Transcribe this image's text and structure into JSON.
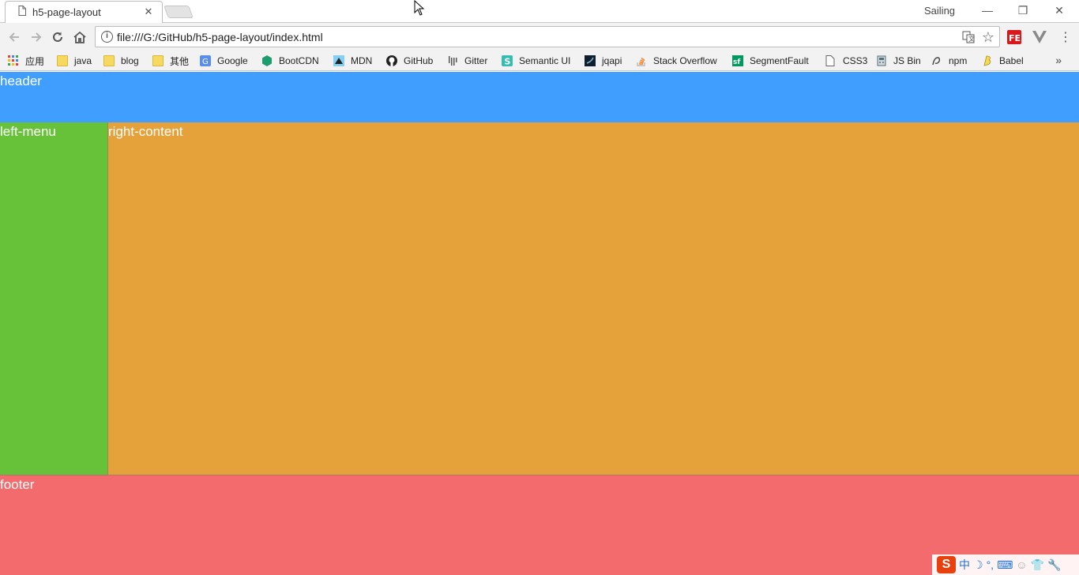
{
  "browser": {
    "tab": {
      "title": "h5-page-layout",
      "close": "✕"
    },
    "profile_name": "Sailing",
    "window_controls": {
      "minimize": "—",
      "restore": "❐",
      "close": "✕"
    },
    "address": "file:///G:/GitHub/h5-page-layout/index.html",
    "bookmarks": [
      {
        "label": "应用",
        "icon": "apps-grid-icon"
      },
      {
        "label": "java",
        "icon": "folder-icon"
      },
      {
        "label": "blog",
        "icon": "folder-icon"
      },
      {
        "label": "其他",
        "icon": "folder-icon"
      },
      {
        "label": "Google",
        "icon": "google-icon"
      },
      {
        "label": "BootCDN",
        "icon": "bootcdn-icon"
      },
      {
        "label": "MDN",
        "icon": "mdn-icon"
      },
      {
        "label": "GitHub",
        "icon": "github-icon"
      },
      {
        "label": "Gitter",
        "icon": "gitter-icon"
      },
      {
        "label": "Semantic UI",
        "icon": "semantic-ui-icon"
      },
      {
        "label": "jqapi",
        "icon": "jqapi-icon"
      },
      {
        "label": "Stack Overflow",
        "icon": "stackoverflow-icon"
      },
      {
        "label": "SegmentFault",
        "icon": "segmentfault-icon"
      },
      {
        "label": "CSS3",
        "icon": "page-icon"
      },
      {
        "label": "JS Bin",
        "icon": "jsbin-icon"
      },
      {
        "label": "npm",
        "icon": "npm-icon"
      },
      {
        "label": "Babel",
        "icon": "babel-icon"
      }
    ],
    "bookmarks_more": "»"
  },
  "page": {
    "header": "header",
    "left_menu": "left-menu",
    "right_content": "right-content",
    "footer": "footer"
  },
  "ime": {
    "logo": "S",
    "mode": "中",
    "moon": "☽",
    "punct": "°,",
    "keyboard": "⌨",
    "person": "☺",
    "shirt": "👕",
    "wrench": "🔧"
  },
  "colors": {
    "header": "#409eff",
    "left_menu": "#67c23a",
    "right_content": "#e6a23a",
    "footer": "#f36b6d"
  }
}
